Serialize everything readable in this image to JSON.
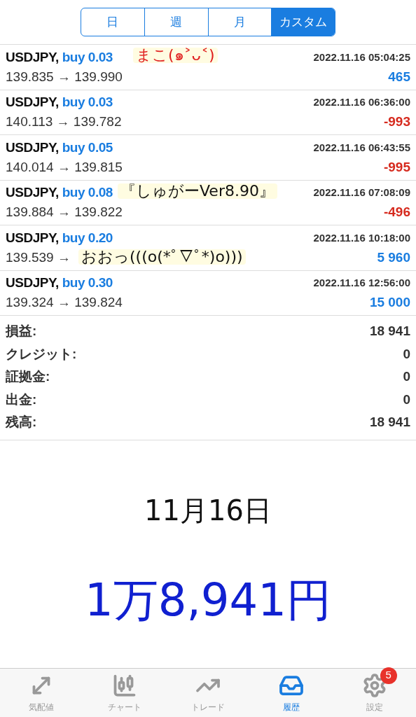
{
  "period_tabs": [
    {
      "label": "日",
      "selected": false
    },
    {
      "label": "週",
      "selected": false
    },
    {
      "label": "月",
      "selected": false
    },
    {
      "label": "カスタム",
      "selected": true
    }
  ],
  "deals": [
    {
      "symbol": "USDJPY,",
      "side": "buy 0.03",
      "time": "2022.11.16 05:04:25",
      "prices": "139.835 → 139.990",
      "profit": "465",
      "kind": "gain",
      "note": {
        "text": "まこ(๑˃ᴗ˂)",
        "color": "#e02020"
      }
    },
    {
      "symbol": "USDJPY,",
      "side": "buy 0.03",
      "time": "2022.11.16 06:36:00",
      "prices": "140.113 → 139.782",
      "profit": "-993",
      "kind": "loss"
    },
    {
      "symbol": "USDJPY,",
      "side": "buy 0.05",
      "time": "2022.11.16 06:43:55",
      "prices": "140.014 → 139.815",
      "profit": "-995",
      "kind": "loss"
    },
    {
      "symbol": "USDJPY,",
      "side": "buy 0.08",
      "time": "2022.11.16 07:08:09",
      "prices": "139.884 → 139.822",
      "profit": "-496",
      "kind": "loss",
      "note": {
        "text": "『しゅがーVer8.90』",
        "color": "#111111"
      }
    },
    {
      "symbol": "USDJPY,",
      "side": "buy 0.20",
      "time": "2022.11.16 10:18:00",
      "prices": "139.539 →",
      "profit": "5 960",
      "kind": "gain",
      "note": {
        "text": "おおっ(((o(*ﾟ▽ﾟ*)o)))",
        "color": "#111111"
      }
    },
    {
      "symbol": "USDJPY,",
      "side": "buy 0.30",
      "time": "2022.11.16 12:56:00",
      "prices": "139.324 → 139.824",
      "profit": "15 000",
      "kind": "gain"
    }
  ],
  "summary": [
    {
      "label": "損益:",
      "value": "18 941"
    },
    {
      "label": "クレジット:",
      "value": "0"
    },
    {
      "label": "証拠金:",
      "value": "0"
    },
    {
      "label": "出金:",
      "value": "0"
    },
    {
      "label": "残高:",
      "value": "18 941"
    }
  ],
  "handwritten": [
    {
      "text": "11月16日",
      "color": "#111111"
    },
    {
      "text": "1万8,941円",
      "color": "#1020d0"
    }
  ],
  "bottom_tabs": [
    {
      "label": "気配値",
      "kind": "quotes",
      "selected": false
    },
    {
      "label": "チャート",
      "kind": "chart",
      "selected": false
    },
    {
      "label": "トレード",
      "kind": "trade",
      "selected": false
    },
    {
      "label": "履歴",
      "kind": "history",
      "selected": true
    },
    {
      "label": "設定",
      "kind": "settings",
      "selected": false,
      "badge": "5"
    }
  ]
}
